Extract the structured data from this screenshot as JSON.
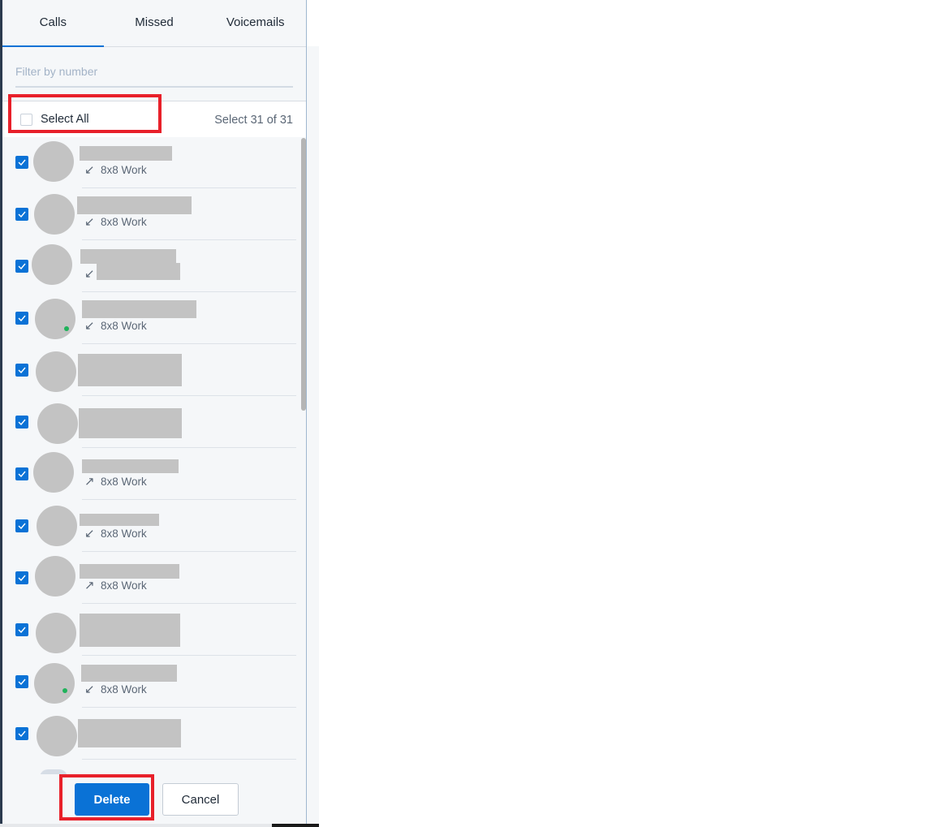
{
  "tabs": [
    {
      "label": "Calls",
      "active": true
    },
    {
      "label": "Missed",
      "active": false
    },
    {
      "label": "Voicemails",
      "active": false
    }
  ],
  "filter": {
    "placeholder": "Filter by number",
    "value": ""
  },
  "select_all": {
    "label": "Select All",
    "checked": false,
    "count_text": "Select 31 of 31"
  },
  "calls": [
    {
      "name": "[redacted]",
      "direction": "incoming",
      "direction_icon": "↙",
      "line": "8x8 Work",
      "checked": true
    },
    {
      "name": "[redacted]",
      "direction": "incoming",
      "direction_icon": "↙",
      "line": "8x8 Work",
      "checked": true
    },
    {
      "name": "[redacted]",
      "direction": "incoming",
      "direction_icon": "↙",
      "line": "[redacted]",
      "checked": true
    },
    {
      "name": "[redacted]",
      "direction": "incoming",
      "direction_icon": "↙",
      "line": "8x8 Work",
      "checked": true,
      "status": "online"
    },
    {
      "name": "[redacted]",
      "direction": "",
      "direction_icon": "",
      "line": "",
      "checked": true
    },
    {
      "name": "[redacted]",
      "direction": "",
      "direction_icon": "",
      "line": "",
      "checked": true
    },
    {
      "name": "[redacted]",
      "direction": "outgoing",
      "direction_icon": "↗",
      "line": "8x8 Work",
      "checked": true
    },
    {
      "name": "[redacted]",
      "direction": "incoming",
      "direction_icon": "↙",
      "line": "8x8 Work",
      "checked": true
    },
    {
      "name": "[redacted]",
      "direction": "outgoing",
      "direction_icon": "↗",
      "line": "8x8 Work",
      "checked": true
    },
    {
      "name": "[redacted]",
      "direction": "",
      "direction_icon": "",
      "line": "",
      "checked": true
    },
    {
      "name": "[redacted]",
      "direction": "incoming",
      "direction_icon": "↙",
      "line": "8x8 Work",
      "checked": true,
      "status": "online"
    },
    {
      "name": "[redacted]",
      "direction": "",
      "direction_icon": "",
      "line": "",
      "checked": true
    }
  ],
  "actions": {
    "delete_label": "Delete",
    "cancel_label": "Cancel"
  },
  "colors": {
    "accent": "#0a72d6",
    "highlight": "#e8202a",
    "online": "#1fb25a"
  }
}
